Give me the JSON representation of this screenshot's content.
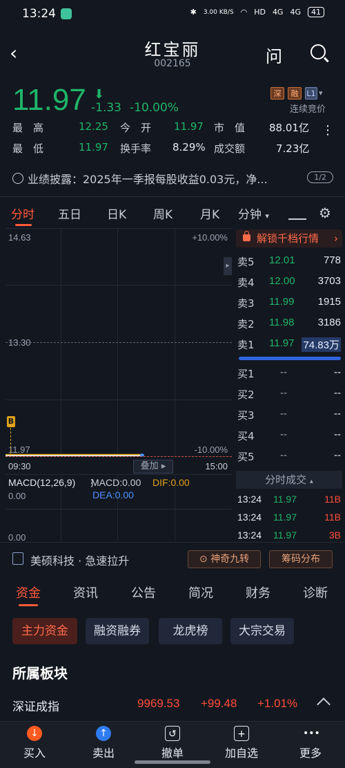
{
  "status_bar": {
    "time": "13:24",
    "net_speed": "3.00 KB/S",
    "hd": "HD",
    "sig1": "4G",
    "sig2": "4G",
    "battery": "41"
  },
  "header": {
    "stock_name": "红宝丽",
    "stock_code": "002165",
    "ask_label": "问"
  },
  "quote": {
    "price": "11.97",
    "change": "-1.33",
    "change_pct": "-10.00%",
    "badges": [
      "深",
      "融",
      "L1"
    ],
    "auction_label": "连续竞价",
    "stats": [
      [
        {
          "label": "最　高",
          "value": "12.25",
          "color": "green"
        },
        {
          "label": "今　开",
          "value": "11.97",
          "color": "green"
        },
        {
          "label": "市　值",
          "value": "88.01亿",
          "color": "white"
        }
      ],
      [
        {
          "label": "最　低",
          "value": "11.97",
          "color": "green"
        },
        {
          "label": "换手率",
          "value": "8.29%",
          "color": "white"
        },
        {
          "label": "成交额",
          "value": "7.23亿",
          "color": "white"
        }
      ]
    ],
    "more_icon": "vertical-dots-icon"
  },
  "notice": {
    "text": "业绩披露：2025年一季报每股收益0.03元，净...",
    "pager": "1/2"
  },
  "chart_tabs": [
    "分时",
    "五日",
    "日K",
    "周K",
    "月K",
    "分钟"
  ],
  "chart": {
    "price_top": "14.63",
    "price_mid": "13.30",
    "price_bot": "11.97",
    "pct_top": "+10.00%",
    "pct_bot": "-10.00%",
    "time_start": "09:30",
    "time_end": "15:00",
    "overlay_label": "叠加",
    "b_marker": "B",
    "macd_title": "MACD(12,26,9)",
    "macd_label": "MACD:0.00",
    "dif_label": "DIF:0.00",
    "dea_label": "DEA:0.00",
    "macd_top": "0.00",
    "macd_bot": "0.00"
  },
  "chart_data": {
    "type": "line",
    "x": [
      "09:30"
    ],
    "series": [
      {
        "values": [
          11.97
        ]
      }
    ],
    "ylim": [
      11.97,
      14.63
    ]
  },
  "order_book": {
    "unlock_label": "解锁千档行情",
    "asks": [
      {
        "label": "卖5",
        "price": "12.01",
        "vol": "778"
      },
      {
        "label": "卖4",
        "price": "12.00",
        "vol": "3703"
      },
      {
        "label": "卖3",
        "price": "11.99",
        "vol": "1915"
      },
      {
        "label": "卖2",
        "price": "11.98",
        "vol": "3186"
      },
      {
        "label": "卖1",
        "price": "11.97",
        "vol": "74.83万"
      }
    ],
    "bids": [
      {
        "label": "买1",
        "price": "--",
        "vol": "--"
      },
      {
        "label": "买2",
        "price": "--",
        "vol": "--"
      },
      {
        "label": "买3",
        "price": "--",
        "vol": "--"
      },
      {
        "label": "买4",
        "price": "--",
        "vol": "--"
      },
      {
        "label": "买5",
        "price": "--",
        "vol": "--"
      }
    ],
    "ticks_header": "分时成交",
    "ticks": [
      {
        "time": "13:24",
        "price": "11.97",
        "vol": "11B"
      },
      {
        "time": "13:24",
        "price": "11.97",
        "vol": "11B"
      },
      {
        "time": "13:24",
        "price": "11.97",
        "vol": "3B"
      }
    ]
  },
  "news_line": {
    "text": "美硕科技 · 急速拉升",
    "pill1": "神奇九转",
    "pill2": "筹码分布"
  },
  "bottom_tabs": [
    "资金",
    "资讯",
    "公告",
    "简况",
    "财务",
    "诊断"
  ],
  "sub_chips": [
    "主力资金",
    "融资融券",
    "龙虎榜",
    "大宗交易"
  ],
  "section_title": "所属板块",
  "index_row": {
    "name": "深证成指",
    "value": "9969.53",
    "change": "+99.48",
    "pct": "+1.01%"
  },
  "bottom_bar": [
    "买入",
    "卖出",
    "撤单",
    "加自选",
    "更多"
  ],
  "colors": {
    "up": "#ff4d3a",
    "down": "#1fb56a",
    "bg": "#13171f"
  }
}
